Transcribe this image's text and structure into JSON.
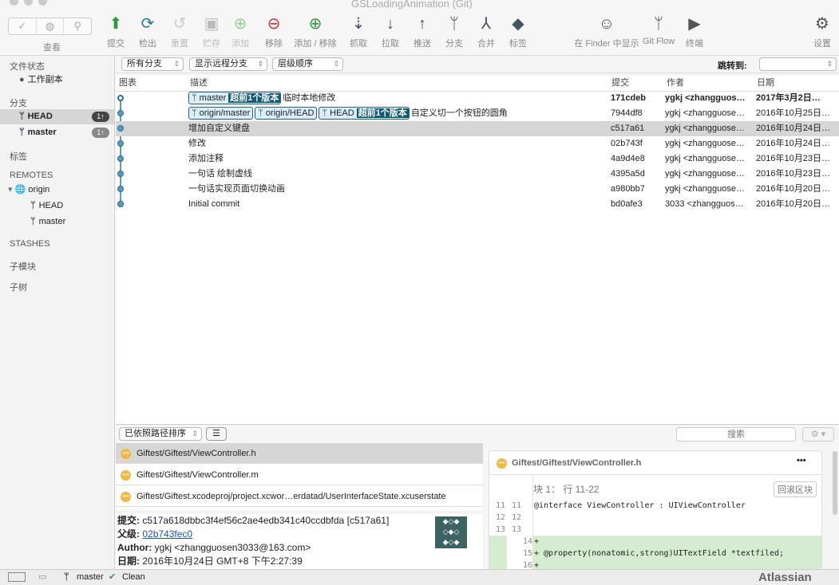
{
  "window": {
    "title": "GSLoadingAnimation (Git)"
  },
  "toolbar": {
    "view_label": "查看",
    "buttons": [
      {
        "label": "提交",
        "icon": "commit-icon",
        "enabled": true
      },
      {
        "label": "检出",
        "icon": "checkout-icon",
        "enabled": true
      },
      {
        "label": "重置",
        "icon": "reset-icon",
        "enabled": false
      },
      {
        "label": "贮存",
        "icon": "stash-icon",
        "enabled": false
      },
      {
        "label": "添加",
        "icon": "add-icon",
        "enabled": false
      },
      {
        "label": "移除",
        "icon": "remove-icon",
        "enabled": true
      },
      {
        "label": "添加 / 移除",
        "icon": "add-remove-icon",
        "enabled": true
      },
      {
        "label": "抓取",
        "icon": "fetch-icon",
        "enabled": true
      },
      {
        "label": "拉取",
        "icon": "pull-icon",
        "enabled": true
      },
      {
        "label": "推送",
        "icon": "push-icon",
        "enabled": true,
        "badge": "1"
      },
      {
        "label": "分支",
        "icon": "branch-icon",
        "enabled": true
      },
      {
        "label": "合并",
        "icon": "merge-icon",
        "enabled": true
      },
      {
        "label": "标签",
        "icon": "tag-icon",
        "enabled": true
      }
    ],
    "right": [
      {
        "label": "在 Finder 中显示",
        "icon": "finder-icon"
      },
      {
        "label": "Git Flow",
        "icon": "git-flow-icon"
      },
      {
        "label": "终端",
        "icon": "terminal-icon"
      },
      {
        "label": "设置",
        "icon": "gear-icon"
      }
    ]
  },
  "sidebar": {
    "file_status": "文件状态",
    "working_copy": "工作副本",
    "branches": "分支",
    "branch_items": [
      {
        "name": "HEAD",
        "badge": "1↑"
      },
      {
        "name": "master",
        "badge": "1↑"
      }
    ],
    "tags": "标签",
    "remotes": "REMOTES",
    "origin": "origin",
    "remote_items": [
      "HEAD",
      "master"
    ],
    "stashes": "STASHES",
    "submodules": "子模块",
    "subtrees": "子树"
  },
  "filters": {
    "branches": "所有分支",
    "remote": "显示远程分支",
    "order": "层级顺序",
    "jump_label": "跳转到:",
    "jump_value": ""
  },
  "columns": {
    "graph": "图表",
    "desc": "描述",
    "commit": "提交",
    "author": "作者",
    "date": "日期"
  },
  "commits": [
    {
      "tags": [
        {
          "name": "master",
          "ahead": "超前1个版本"
        }
      ],
      "desc": "临时本地修改",
      "hash": "171cdeb",
      "author": "ygkj <zhangguos…",
      "date": "2017年3月2日…",
      "bold": true
    },
    {
      "tags": [
        {
          "name": "origin/master"
        },
        {
          "name": "origin/HEAD"
        },
        {
          "name": "HEAD",
          "ahead": "超前1个版本"
        }
      ],
      "desc": "自定义切一个按钮的圆角",
      "hash": "7944df8",
      "author": "ygkj <zhangguose…",
      "date": "2016年10月25日…"
    },
    {
      "tags": [],
      "desc": "增加自定义键盘",
      "hash": "c517a61",
      "author": "ygkj <zhangguose…",
      "date": "2016年10月24日…",
      "selected": true
    },
    {
      "tags": [],
      "desc": "修改",
      "hash": "02b743f",
      "author": "ygkj <zhangguose…",
      "date": "2016年10月24日…"
    },
    {
      "tags": [],
      "desc": "添加注释",
      "hash": "4a9d4e8",
      "author": "ygkj <zhangguose…",
      "date": "2016年10月23日…"
    },
    {
      "tags": [],
      "desc": "一句话 绘制虚线",
      "hash": "4395a5d",
      "author": "ygkj <zhangguose…",
      "date": "2016年10月23日…"
    },
    {
      "tags": [],
      "desc": "一句话实现页面切换动画",
      "hash": "a980bb7",
      "author": "ygkj <zhangguose…",
      "date": "2016年10月20日…"
    },
    {
      "tags": [],
      "desc": "Initial commit",
      "hash": "bd0afe3",
      "author": "3033 <zhangguos…",
      "date": "2016年10月20日…"
    }
  ],
  "bottom": {
    "sort": "已依照路径排序",
    "search_placeholder": "搜索"
  },
  "files": [
    "Giftest/Giftest/ViewController.h",
    "Giftest/Giftest/ViewController.m",
    "Giftest/Giftest.xcodeproj/project.xcwor…erdatad/UserInterfaceState.xcuserstate"
  ],
  "details": {
    "commit_label": "提交:",
    "commit_value": "c517a618dbbc3f4ef56c2ae4edb341c40ccdbfda [c517a61]",
    "parent_label": "父级:",
    "parent_value": "02b743fec0",
    "author_label": "Author:",
    "author_value": "ygkj <zhangguosen3033@163.com>",
    "date_label": "日期:",
    "date_value": "2016年10月24日 GMT+8 下午2:27:39"
  },
  "diff": {
    "file": "Giftest/Giftest/ViewController.h",
    "more": "•••",
    "hunk": "块 1： 行 11-22",
    "revert": "回滚区块",
    "lines": [
      {
        "old": "11",
        "new": "11",
        "text": " @interface ViewController : UIViewController",
        "type": "ctx"
      },
      {
        "old": "12",
        "new": "12",
        "text": "",
        "type": "ctx"
      },
      {
        "old": "13",
        "new": "13",
        "text": "",
        "type": "ctx"
      },
      {
        "old": "",
        "new": "14",
        "text": "+",
        "type": "add"
      },
      {
        "old": "",
        "new": "15",
        "text": "+ @property(nonatomic,strong)UITextField *textfiled;",
        "type": "add"
      },
      {
        "old": "",
        "new": "16",
        "text": "+",
        "type": "add"
      }
    ]
  },
  "status": {
    "branch": "master",
    "state": "Clean",
    "brand": "Atlassian"
  },
  "colors": {
    "accent": "#0f5a78",
    "add_bg": "#d5ecd0",
    "file_modified": "#f4b83e"
  }
}
